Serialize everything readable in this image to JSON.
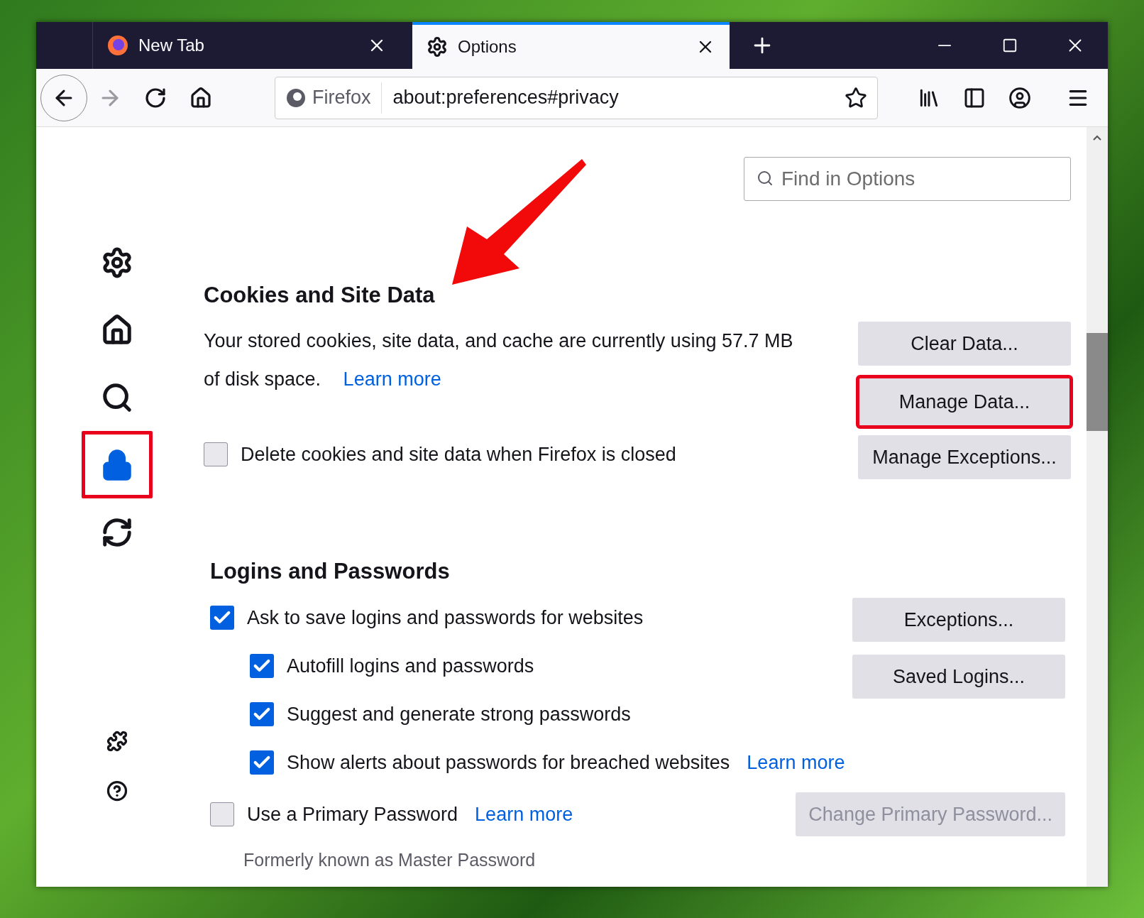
{
  "tabs": [
    {
      "label": "New Tab",
      "selected": false,
      "kind": "firefox"
    },
    {
      "label": "Options",
      "selected": true,
      "kind": "gear"
    }
  ],
  "toolbar": {
    "identity": "Firefox",
    "url": "about:preferences#privacy"
  },
  "search": {
    "placeholder": "Find in Options"
  },
  "sidebar": {
    "items": [
      {
        "kind": "general",
        "selected": false,
        "highlighted": false
      },
      {
        "kind": "home",
        "selected": false,
        "highlighted": false
      },
      {
        "kind": "search",
        "selected": false,
        "highlighted": false
      },
      {
        "kind": "privacy",
        "selected": true,
        "highlighted": true
      },
      {
        "kind": "sync",
        "selected": false,
        "highlighted": false
      }
    ],
    "bottom_items": [
      {
        "kind": "extensions"
      },
      {
        "kind": "help"
      }
    ]
  },
  "cookies": {
    "title": "Cookies and Site Data",
    "description": "Your stored cookies, site data, and cache are currently using 57.7 MB of disk space.",
    "link": "Learn more",
    "buttons": [
      {
        "label": "Clear Data...",
        "highlighted": false
      },
      {
        "label": "Manage Data...",
        "highlighted": true
      },
      {
        "label": "Manage Exceptions...",
        "highlighted": false
      }
    ],
    "delete_option": {
      "label": "Delete cookies and site data when Firefox is closed",
      "checked": false
    }
  },
  "logins": {
    "title": "Logins and Passwords",
    "options": [
      {
        "label": "Ask to save logins and passwords for websites",
        "checked": true,
        "children": [
          {
            "label": "Autofill logins and passwords",
            "checked": true
          },
          {
            "label": "Suggest and generate strong passwords",
            "checked": true
          },
          {
            "label": "Show alerts about passwords for breached websites",
            "checked": true,
            "link": "Learn more"
          }
        ]
      }
    ],
    "buttons": [
      {
        "label": "Exceptions...",
        "disabled": false
      },
      {
        "label": "Saved Logins...",
        "disabled": false
      }
    ],
    "primary_password": {
      "label": "Use a Primary Password",
      "checked": false,
      "link": "Learn more",
      "note": "Formerly known as Master Password",
      "button": {
        "label": "Change Primary Password...",
        "disabled": true
      }
    }
  },
  "annotation": {
    "arrow": true
  }
}
